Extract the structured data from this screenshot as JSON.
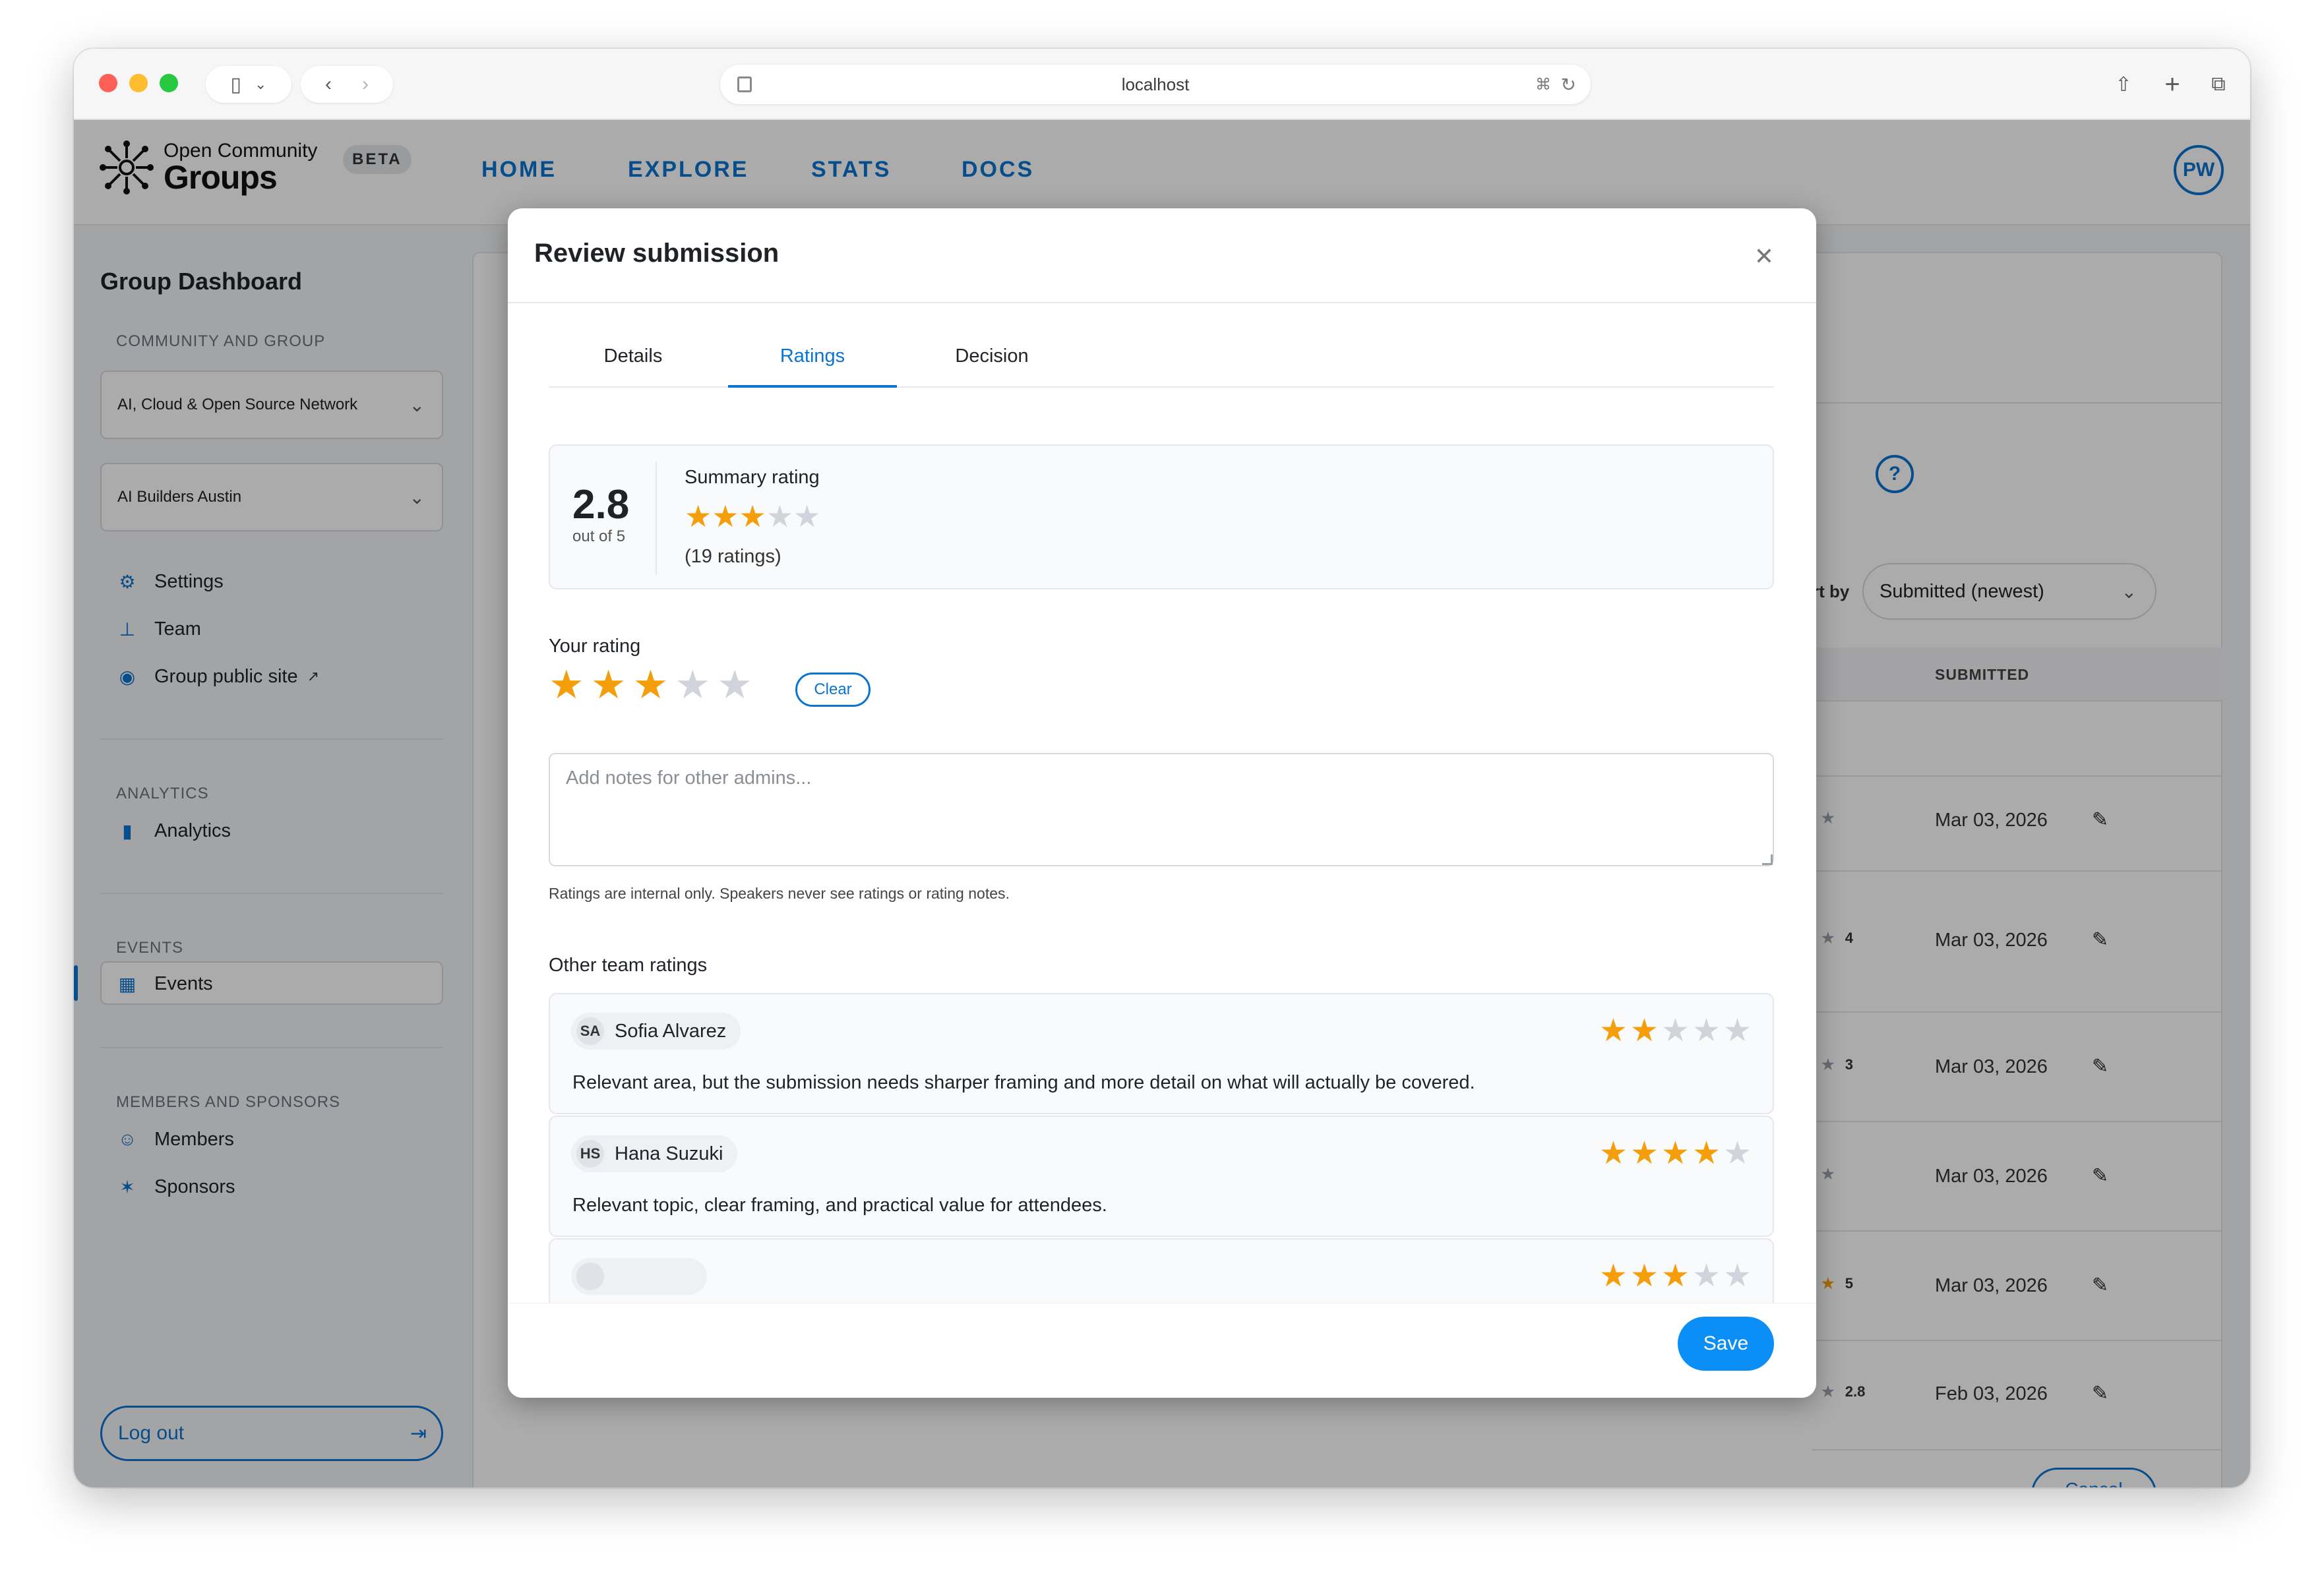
{
  "browser": {
    "url": "localhost"
  },
  "app": {
    "logo_top": "Open Community",
    "logo_bottom": "Groups",
    "badge": "BETA",
    "nav": [
      "HOME",
      "EXPLORE",
      "STATS",
      "DOCS"
    ],
    "user_initials": "PW"
  },
  "sidebar": {
    "title": "Group Dashboard",
    "section_community": "COMMUNITY AND GROUP",
    "community_select": "AI, Cloud & Open Source Network",
    "group_select": "AI Builders Austin",
    "settings": "Settings",
    "team": "Team",
    "public_site": "Group public site",
    "section_analytics": "ANALYTICS",
    "analytics": "Analytics",
    "section_events": "EVENTS",
    "events": "Events",
    "section_members": "MEMBERS AND SPONSORS",
    "members": "Members",
    "sponsors": "Sponsors",
    "logout": "Log out"
  },
  "background_table": {
    "sort_label": "rt by",
    "sort_value": "Submitted (newest)",
    "col_submitted": "SUBMITTED",
    "rows": [
      {
        "rating": "",
        "filled": false,
        "date": "Mar 03, 2026"
      },
      {
        "rating": "4",
        "filled": false,
        "date": "Mar 03, 2026"
      },
      {
        "rating": "3",
        "filled": false,
        "date": "Mar 03, 2026"
      },
      {
        "rating": "",
        "filled": false,
        "date": "Mar 03, 2026"
      },
      {
        "rating": "5",
        "filled": true,
        "date": "Mar 03, 2026"
      },
      {
        "rating": "2.8",
        "filled": false,
        "date": "Feb 03, 2026"
      }
    ],
    "cancel": "Cancel"
  },
  "modal": {
    "title": "Review submission",
    "tabs": [
      "Details",
      "Ratings",
      "Decision"
    ],
    "active_tab": "Ratings",
    "summary": {
      "score": "2.8",
      "out_of": "out of 5",
      "label": "Summary rating",
      "stars_filled": 3,
      "count": "(19 ratings)"
    },
    "your_rating": {
      "label": "Your rating",
      "stars_filled": 3,
      "clear": "Clear"
    },
    "notes_placeholder": "Add notes for other admins...",
    "hint": "Ratings are internal only. Speakers never see ratings or rating notes.",
    "other_label": "Other team ratings",
    "other_ratings": [
      {
        "initials": "SA",
        "name": "Sofia Alvarez",
        "stars": 2,
        "comment": "Relevant area, but the submission needs sharper framing and more detail on what will actually be covered."
      },
      {
        "initials": "HS",
        "name": "Hana Suzuki",
        "stars": 4,
        "comment": "Relevant topic, clear framing, and practical value for attendees."
      },
      {
        "initials": "",
        "name": "",
        "stars": 3,
        "comment": ""
      }
    ],
    "save": "Save"
  },
  "colors": {
    "accent": "#0b74d1",
    "star": "#f59e0b",
    "save_button": "#0b8ef5"
  }
}
